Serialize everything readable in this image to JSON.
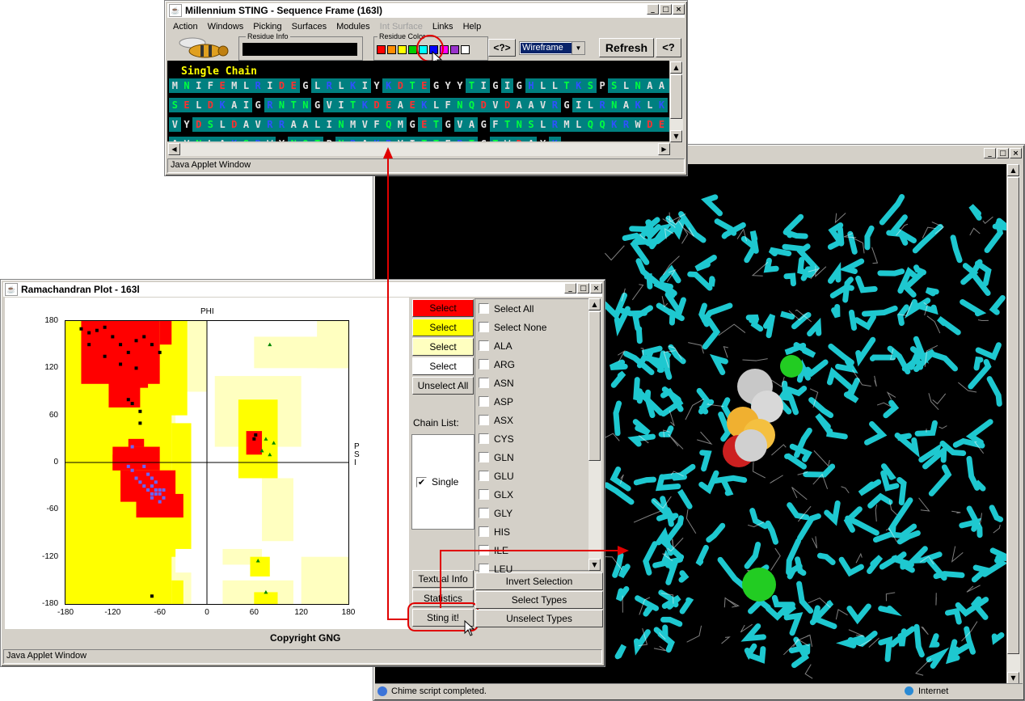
{
  "sequence_window": {
    "title": "Millennium STING - Sequence Frame (163l)",
    "menu": [
      "Action",
      "Windows",
      "Picking",
      "Surfaces",
      "Modules",
      "Int Surface",
      "Links",
      "Help"
    ],
    "residue_info_label": "Residue Info",
    "residue_color_label": "Residue Color",
    "query_button": "<?>",
    "render_mode": "Wireframe",
    "refresh_button": "Refresh",
    "help_button": "<?",
    "chain_label": "Single Chain",
    "status": "Java Applet Window",
    "swatch_colors": [
      "#ff0000",
      "#ff8c00",
      "#ffff00",
      "#00cc00",
      "#00ffff",
      "#0000ff",
      "#ff00ff",
      "#9933cc",
      "#ffffff"
    ],
    "rows": [
      "MNIFEMLRIDEGLRLKIYKDTEGYYTIGIGHLLTKSPSLNAAK",
      "SELDKAIGRNTNGVITKDEAEKLFNQDVDAAVRGILRNAKLKP",
      "VYDSLDAVRRAALINMVFQMGETGVAGFTNSLRMLQQKRWDEA",
      "AVNLAKSRWYNQTPNRAKRVITTFRTGTWDAYK"
    ]
  },
  "chime_window": {
    "status": "Chime script completed.",
    "zone": "Internet"
  },
  "rama_window": {
    "title": "Ramachandran Plot - 163l",
    "x_axis_label": "PHI",
    "y_axis_label": "PSI",
    "x_ticks": [
      "-180",
      "-120",
      "-60",
      "0",
      "60",
      "120",
      "180"
    ],
    "y_ticks": [
      "180",
      "120",
      "60",
      "0",
      "-60",
      "-120",
      "-180"
    ],
    "select_buttons": [
      "Select",
      "Select",
      "Select",
      "Select"
    ],
    "select_colors": [
      "#ff0000",
      "#ffff00",
      "#ffffc0",
      "#ffffff"
    ],
    "unselect_all": "Unselect All",
    "chain_list_label": "Chain List:",
    "chain_item": "Single",
    "textual_info": "Textual Info",
    "statistics": "Statistics",
    "sting_button": "Sting it!",
    "copyright": "Copyright GNG",
    "status": "Java Applet Window",
    "types": [
      "Select All",
      "Select None",
      "ALA",
      "ARG",
      "ASN",
      "ASP",
      "ASX",
      "CYS",
      "GLN",
      "GLU",
      "GLX",
      "GLY",
      "HIS",
      "ILE",
      "LEU"
    ],
    "invert_selection": "Invert Selection",
    "select_types": "Select Types",
    "unselect_types": "Unselect Types"
  },
  "chart_data": {
    "type": "scatter",
    "xlabel": "PHI",
    "ylabel": "PSI",
    "xlim": [
      -180,
      180
    ],
    "ylim": [
      -180,
      180
    ],
    "grid": false,
    "series": [
      {
        "name": "",
        "marker": "square",
        "color": "#000000",
        "points": [
          [
            -160,
            170
          ],
          [
            -150,
            165
          ],
          [
            -140,
            168
          ],
          [
            -130,
            172
          ],
          [
            -120,
            160
          ],
          [
            -110,
            150
          ],
          [
            -100,
            140
          ],
          [
            -90,
            155
          ],
          [
            -80,
            160
          ],
          [
            -70,
            150
          ],
          [
            -60,
            140
          ],
          [
            -150,
            150
          ],
          [
            -130,
            135
          ],
          [
            -110,
            125
          ],
          [
            -90,
            120
          ],
          [
            -100,
            80
          ],
          [
            -95,
            75
          ],
          [
            -85,
            65
          ],
          [
            -85,
            50
          ],
          [
            60,
            30
          ],
          [
            62,
            35
          ],
          [
            -70,
            -170
          ]
        ]
      },
      {
        "name": "",
        "marker": "square",
        "color": "#6666ff",
        "points": [
          [
            -100,
            -5
          ],
          [
            -95,
            -10
          ],
          [
            -80,
            -5
          ],
          [
            -75,
            -15
          ],
          [
            -70,
            -20
          ],
          [
            -65,
            -25
          ],
          [
            -70,
            -30
          ],
          [
            -60,
            -35
          ],
          [
            -65,
            -40
          ],
          [
            -55,
            -45
          ],
          [
            -70,
            -45
          ],
          [
            -60,
            -50
          ],
          [
            -75,
            -35
          ],
          [
            -80,
            -30
          ],
          [
            -90,
            -20
          ],
          [
            -85,
            -25
          ],
          [
            -60,
            -40
          ],
          [
            -65,
            -35
          ],
          [
            -70,
            -40
          ],
          [
            -55,
            -35
          ],
          [
            -95,
            20
          ]
        ]
      },
      {
        "name": "",
        "marker": "triangle",
        "color": "#008800",
        "points": [
          [
            80,
            150
          ],
          [
            75,
            30
          ],
          [
            85,
            25
          ],
          [
            70,
            15
          ],
          [
            80,
            10
          ],
          [
            65,
            -125
          ],
          [
            75,
            -165
          ]
        ]
      }
    ]
  }
}
